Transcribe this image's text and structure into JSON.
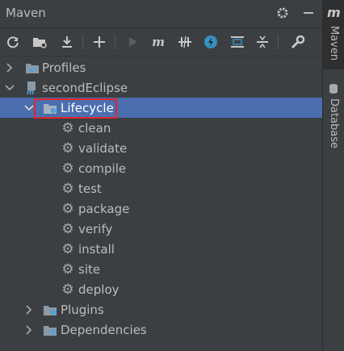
{
  "panel": {
    "title": "Maven",
    "header_buttons": [
      "gear-icon",
      "minimize-icon"
    ]
  },
  "toolbar": {
    "buttons": [
      "reload-icon",
      "generate-sources-icon",
      "download-icon",
      "add-icon",
      "run-icon",
      "execute-goal-icon",
      "toggle-offline-icon",
      "skip-tests-icon",
      "show-dependencies-icon",
      "collapse-all-icon",
      "settings-wrench-icon"
    ]
  },
  "tree": {
    "profiles": "Profiles",
    "project": "secondEclipse",
    "lifecycle": "Lifecycle",
    "goals": [
      "clean",
      "validate",
      "compile",
      "test",
      "package",
      "verify",
      "install",
      "site",
      "deploy"
    ],
    "plugins": "Plugins",
    "dependencies": "Dependencies"
  },
  "side": {
    "maven": "Maven",
    "database": "Database"
  },
  "colors": {
    "selection": "#4b6eaf",
    "highlight_border": "#e0262e",
    "background": "#3c3f41"
  }
}
